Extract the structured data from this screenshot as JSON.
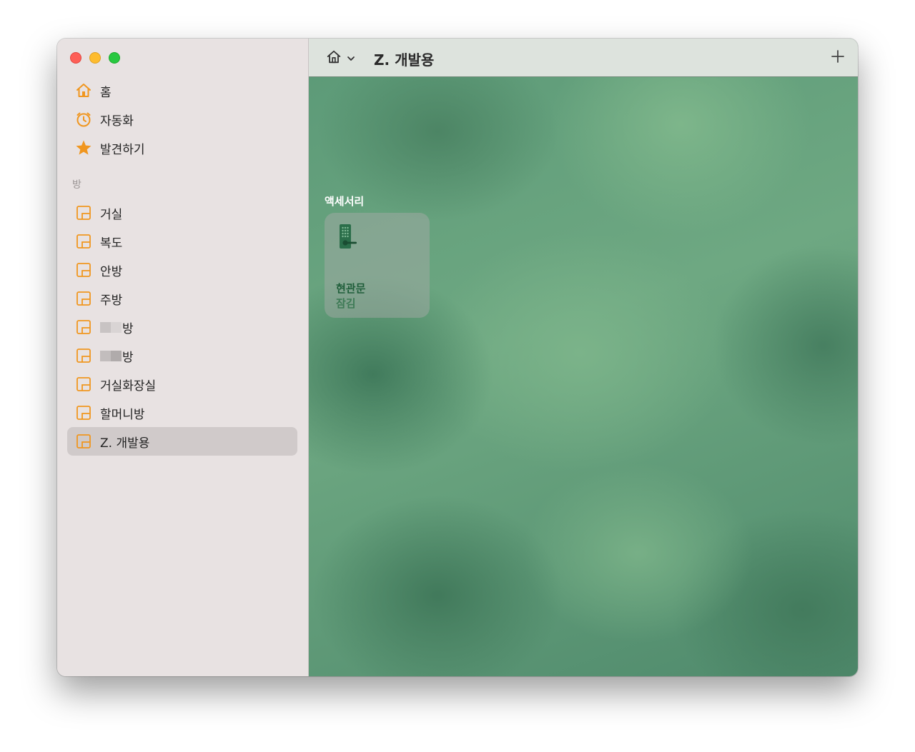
{
  "window": {
    "title": "Z. 개발용"
  },
  "sidebar": {
    "main_items": [
      {
        "label": "홈",
        "icon": "house-icon"
      },
      {
        "label": "자동화",
        "icon": "alarm-clock-icon"
      },
      {
        "label": "발견하기",
        "icon": "star-icon"
      }
    ],
    "rooms_header": "방",
    "rooms": [
      {
        "label": "거실"
      },
      {
        "label": "복도"
      },
      {
        "label": "안방"
      },
      {
        "label": "주방"
      },
      {
        "label": "방",
        "redacted_prefix": true
      },
      {
        "label": "방",
        "redacted_prefix": true
      },
      {
        "label": "거실화장실"
      },
      {
        "label": "할머니방"
      },
      {
        "label": "Z. 개발용",
        "selected": true
      }
    ]
  },
  "toolbar": {
    "title": "Z. 개발용",
    "home_icon": "house-icon",
    "menu_icon": "chevron-down-icon",
    "add_icon": "plus-icon"
  },
  "accessories": {
    "section_title": "액세서리",
    "tiles": [
      {
        "name": "현관문",
        "status": "잠김",
        "icon": "door-lock-icon"
      }
    ]
  },
  "colors": {
    "accent": "#f0961f",
    "sidebar_bg": "#e8e2e2",
    "selected_bg": "#d0caca",
    "tile_name": "#1f5e3a"
  }
}
